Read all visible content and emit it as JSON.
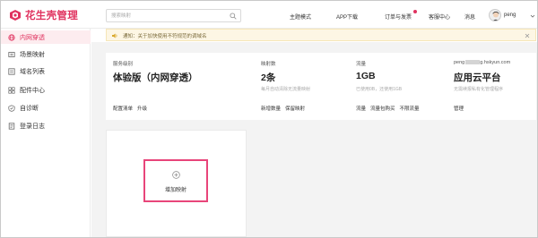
{
  "brand": {
    "name": "花生壳管理",
    "accent": "#e0325f"
  },
  "search": {
    "placeholder": "搜索映射"
  },
  "topnav": {
    "theme": "主题模式",
    "app": "APP下载",
    "orders": "订单与发票",
    "support": "客服中心",
    "messages": "消息"
  },
  "user": {
    "name": "peng"
  },
  "sidebar": {
    "items": [
      {
        "label": "内网穿透",
        "icon": "globe-icon",
        "active": true
      },
      {
        "label": "场景映射",
        "icon": "scene-icon",
        "active": false
      },
      {
        "label": "域名列表",
        "icon": "list-icon",
        "active": false
      },
      {
        "label": "配件中心",
        "icon": "grid-icon",
        "active": false
      },
      {
        "label": "自诊断",
        "icon": "diagnose-icon",
        "active": false
      },
      {
        "label": "登录日志",
        "icon": "log-icon",
        "active": false
      }
    ]
  },
  "notice": {
    "text": "通知：关于加快使用不符规范的调域名"
  },
  "panel": {
    "service": {
      "label": "服务级别",
      "value": "体验版（内网穿透）",
      "links": [
        "配置清单",
        "升级"
      ]
    },
    "mappings": {
      "label": "映射数",
      "value": "2条",
      "sub": "每月自动清除无流量映射",
      "links": [
        "新增数量",
        "保留映射"
      ]
    },
    "traffic": {
      "label": "流量",
      "value": "1GB",
      "sub": "已使用0B，还使用1GB",
      "links": [
        "流量",
        "流量包购买",
        "不限流量"
      ]
    },
    "account": {
      "label_prefix": "peng",
      "label_suffix": "g.hskyun.com",
      "value": "应用云平台",
      "sub": "无需续报私有化管理程序",
      "links": [
        "管理"
      ]
    }
  },
  "add_mapping": {
    "label": "增加映射"
  }
}
